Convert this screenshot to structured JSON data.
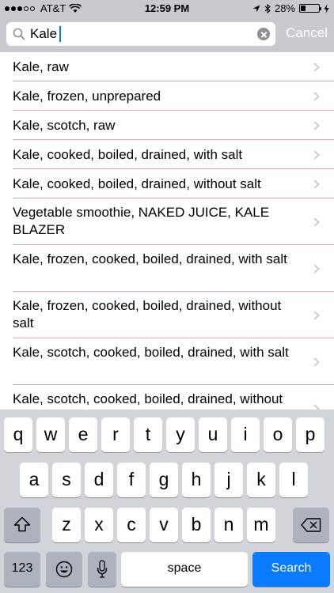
{
  "status_bar": {
    "carrier": "AT&T",
    "time": "12:59 PM",
    "battery": "28%",
    "battery_level": 0.28,
    "signal_bars": 3
  },
  "search": {
    "value": "Kale",
    "cancel_label": "Cancel"
  },
  "results": [
    "Kale, raw",
    "Kale, frozen, unprepared",
    "Kale, scotch, raw",
    "Kale, cooked, boiled, drained, with salt",
    "Kale, cooked, boiled, drained, without salt",
    "Vegetable smoothie, NAKED JUICE, KALE BLAZER",
    "Kale, frozen, cooked, boiled, drained, with salt",
    "Kale, frozen, cooked, boiled, drained, without salt",
    "Kale, scotch, cooked, boiled, drained, with salt",
    "Kale, scotch, cooked, boiled, drained, without salt"
  ],
  "keyboard": {
    "row1": [
      "q",
      "w",
      "e",
      "r",
      "t",
      "y",
      "u",
      "i",
      "o",
      "p"
    ],
    "row2": [
      "a",
      "s",
      "d",
      "f",
      "g",
      "h",
      "j",
      "k",
      "l"
    ],
    "row3": [
      "z",
      "x",
      "c",
      "v",
      "b",
      "n",
      "m"
    ],
    "numbers_label": "123",
    "space_label": "space",
    "search_label": "Search"
  },
  "colors": {
    "accent": "#0a7aff",
    "separator": "#e9a0c6"
  }
}
